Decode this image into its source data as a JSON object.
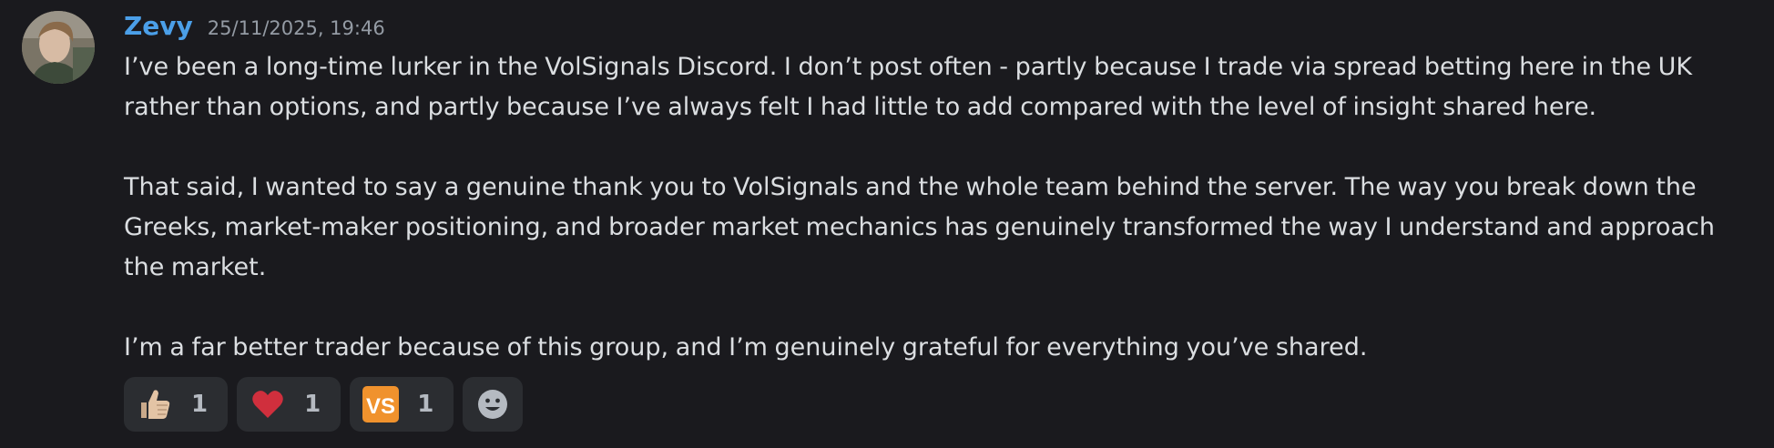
{
  "message": {
    "author": "Zevy",
    "timestamp": "25/11/2025, 19:46",
    "paragraphs": [
      "I’ve been a long-time lurker in the VolSignals Discord. I don’t post often - partly because I trade via spread betting here in the UK\nrather than options, and partly because I’ve always felt I had little to add compared with the level of insight shared here.",
      "That said, I wanted to say a genuine thank you to VolSignals and the whole team behind the server. The way you break down the\nGreeks, market-maker positioning, and broader market mechanics has genuinely transformed the way I understand and approach\nthe market.",
      "I’m a far better trader because of this group, and I’m genuinely grateful for everything you’ve shared."
    ]
  },
  "reactions": [
    {
      "icon": "thumbs-up-icon",
      "count": "1"
    },
    {
      "icon": "heart-icon",
      "count": "1"
    },
    {
      "icon": "vs-logo-icon",
      "logo_text": "VS",
      "count": "1"
    }
  ],
  "add_reaction": {
    "icon": "smiley-icon"
  },
  "colors": {
    "background": "#1a1a1e",
    "username": "#4b9fe8",
    "text": "#dbdee1",
    "timestamp": "#949ba4",
    "reaction_bg": "#2b2d31",
    "heart": "#d02f3d",
    "vs_logo": "#f0922d"
  }
}
